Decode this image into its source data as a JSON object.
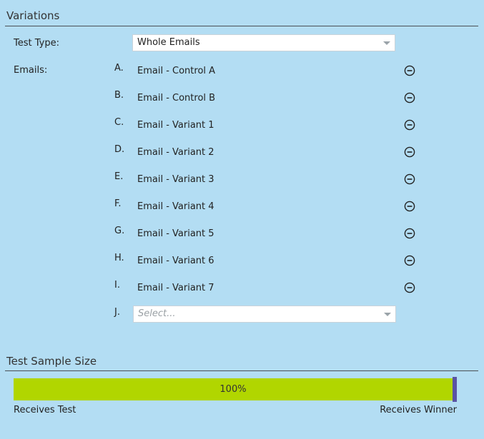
{
  "variations": {
    "title": "Variations",
    "test_type_label": "Test Type:",
    "test_type_value": "Whole Emails",
    "emails_label": "Emails:",
    "emails": [
      {
        "letter": "A.",
        "name": "Email - Control A"
      },
      {
        "letter": "B.",
        "name": "Email - Control B"
      },
      {
        "letter": "C.",
        "name": "Email - Variant 1"
      },
      {
        "letter": "D.",
        "name": "Email - Variant 2"
      },
      {
        "letter": "E.",
        "name": "Email - Variant 3"
      },
      {
        "letter": "F.",
        "name": "Email - Variant 4"
      },
      {
        "letter": "G.",
        "name": "Email - Variant 5"
      },
      {
        "letter": "H.",
        "name": "Email - Variant 6"
      },
      {
        "letter": "I.",
        "name": "Email - Variant 7"
      }
    ],
    "next_letter": "J.",
    "select_placeholder": "Select..."
  },
  "sample_size": {
    "title": "Test Sample Size",
    "percent_text": "100%",
    "percent_value": 100,
    "receives_test_label": "Receives Test",
    "receives_winner_label": "Receives Winner"
  },
  "colors": {
    "background": "#b3ddf3",
    "bar_fill": "#b1d600",
    "bar_handle": "#5a54a3"
  },
  "icons": {
    "remove": "minus-circle-icon",
    "dropdown": "chevron-down-icon"
  }
}
